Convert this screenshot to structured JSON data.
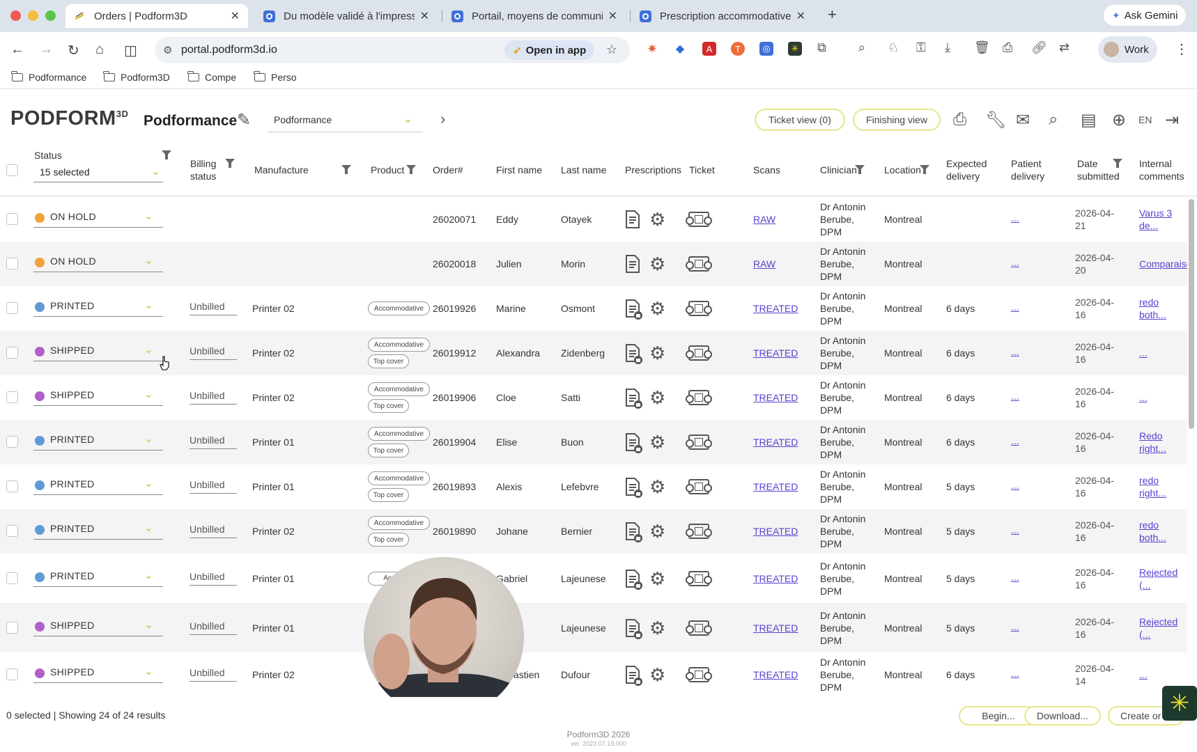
{
  "browser": {
    "tabs": [
      {
        "title": "Orders | Podform3D",
        "active": true
      },
      {
        "title": "Du modèle validé à l'impressi"
      },
      {
        "title": "Portail, moyens de communic"
      },
      {
        "title": "Prescription accommodative,"
      }
    ],
    "gemini_label": "Ask Gemini",
    "url": "portal.podform3d.io",
    "open_in_app": "Open in app",
    "profile_label": "Work",
    "bookmarks": [
      "Podformance",
      "Podform3D",
      "Compe",
      "Perso"
    ]
  },
  "app": {
    "logo": "PODFORM",
    "logo_sup": "3D",
    "org_name": "Podformance",
    "org_select": "Podformance",
    "ticket_view": "Ticket view (0)",
    "finishing_view": "Finishing view",
    "language": "EN"
  },
  "columns": {
    "status": "Status",
    "status_filter_value": "15 selected",
    "billing_1": "Billing",
    "billing_2": "status",
    "manufacture": "Manufacture",
    "product": "Product",
    "order": "Order#",
    "first_name": "First name",
    "last_name": "Last name",
    "prescriptions": "Prescriptions",
    "ticket": "Ticket",
    "scans": "Scans",
    "clinician": "Clinician",
    "location": "Location",
    "expected_1": "Expected",
    "expected_2": "delivery",
    "patient_1": "Patient",
    "patient_2": "delivery",
    "date_1": "Date",
    "date_2": "submitted",
    "comments_1": "Internal",
    "comments_2": "comments"
  },
  "colors": {
    "on_hold": "#f0a23c",
    "printed": "#5d9ad6",
    "shipped": "#b15fc9",
    "accent": "#e8e58a",
    "link": "#5b3fd0"
  },
  "rows": [
    {
      "status": "ON HOLD",
      "status_color": "#f0a23c",
      "billing": "",
      "manufacture": "",
      "tags": [],
      "order": "26020071",
      "first": "Eddy",
      "last": "Otayek",
      "scan": "RAW",
      "clin1": "Dr Antonin",
      "clin2": "Berube,",
      "clin3": "DPM",
      "location": "Montreal",
      "expected": "",
      "patient": "...",
      "date1": "2026-04-",
      "date2": "21",
      "comment1": "Varus 3",
      "comment2": "de..."
    },
    {
      "status": "ON HOLD",
      "status_color": "#f0a23c",
      "billing": "",
      "manufacture": "",
      "tags": [],
      "order": "26020018",
      "first": "Julien",
      "last": "Morin",
      "scan": "RAW",
      "clin1": "Dr Antonin",
      "clin2": "Berube,",
      "clin3": "DPM",
      "location": "Montreal",
      "expected": "",
      "patient": "...",
      "date1": "2026-04-",
      "date2": "20",
      "comment1": "Comparaiso...",
      "comment2": ""
    },
    {
      "status": "PRINTED",
      "status_color": "#5d9ad6",
      "billing": "Unbilled",
      "manufacture": "Printer 02",
      "tags": [
        "Accommodative"
      ],
      "order": "26019926",
      "first": "Marine",
      "last": "Osmont",
      "scan": "TREATED",
      "clin1": "Dr Antonin",
      "clin2": "Berube,",
      "clin3": "DPM",
      "location": "Montreal",
      "expected": "6 days",
      "patient": "...",
      "date1": "2026-04-",
      "date2": "16",
      "comment1": "redo",
      "comment2": "both..."
    },
    {
      "status": "SHIPPED",
      "status_color": "#b15fc9",
      "billing": "Unbilled",
      "manufacture": "Printer 02",
      "tags": [
        "Accommodative",
        "Top cover"
      ],
      "order": "26019912",
      "first": "Alexandra",
      "last": "Zidenberg",
      "scan": "TREATED",
      "clin1": "Dr Antonin",
      "clin2": "Berube,",
      "clin3": "DPM",
      "location": "Montreal",
      "expected": "6 days",
      "patient": "...",
      "date1": "2026-04-",
      "date2": "16",
      "comment1": "...",
      "comment2": ""
    },
    {
      "status": "SHIPPED",
      "status_color": "#b15fc9",
      "billing": "Unbilled",
      "manufacture": "Printer 02",
      "tags": [
        "Accommodative",
        "Top cover"
      ],
      "order": "26019906",
      "first": "Cloe",
      "last": "Satti",
      "scan": "TREATED",
      "clin1": "Dr Antonin",
      "clin2": "Berube,",
      "clin3": "DPM",
      "location": "Montreal",
      "expected": "6 days",
      "patient": "...",
      "date1": "2026-04-",
      "date2": "16",
      "comment1": "...",
      "comment2": ""
    },
    {
      "status": "PRINTED",
      "status_color": "#5d9ad6",
      "billing": "Unbilled",
      "manufacture": "Printer 01",
      "tags": [
        "Accommodative",
        "Top cover"
      ],
      "order": "26019904",
      "first": "Elise",
      "last": "Buon",
      "scan": "TREATED",
      "clin1": "Dr Antonin",
      "clin2": "Berube,",
      "clin3": "DPM",
      "location": "Montreal",
      "expected": "6 days",
      "patient": "...",
      "date1": "2026-04-",
      "date2": "16",
      "comment1": "Redo",
      "comment2": "right..."
    },
    {
      "status": "PRINTED",
      "status_color": "#5d9ad6",
      "billing": "Unbilled",
      "manufacture": "Printer 01",
      "tags": [
        "Accommodative",
        "Top cover"
      ],
      "order": "26019893",
      "first": "Alexis",
      "last": "Lefebvre",
      "scan": "TREATED",
      "clin1": "Dr Antonin",
      "clin2": "Berube,",
      "clin3": "DPM",
      "location": "Montreal",
      "expected": "5 days",
      "patient": "...",
      "date1": "2026-04-",
      "date2": "16",
      "comment1": "redo",
      "comment2": "right..."
    },
    {
      "status": "PRINTED",
      "status_color": "#5d9ad6",
      "billing": "Unbilled",
      "manufacture": "Printer 02",
      "tags": [
        "Accommodative",
        "Top cover"
      ],
      "order": "26019890",
      "first": "Johane",
      "last": "Bernier",
      "scan": "TREATED",
      "clin1": "Dr Antonin",
      "clin2": "Berube,",
      "clin3": "DPM",
      "location": "Montreal",
      "expected": "5 days",
      "patient": "...",
      "date1": "2026-04-",
      "date2": "16",
      "comment1": "redo",
      "comment2": "both..."
    },
    {
      "status": "PRINTED",
      "status_color": "#5d9ad6",
      "billing": "Unbilled",
      "manufacture": "Printer 01",
      "tags": [
        "Accommo"
      ],
      "order": "",
      "first": "Gabriel",
      "last": "Lajeunese",
      "scan": "TREATED",
      "clin1": "Dr Antonin",
      "clin2": "Berube,",
      "clin3": "DPM",
      "location": "Montreal",
      "expected": "5 days",
      "patient": "...",
      "date1": "2026-04-",
      "date2": "16",
      "comment1": "Rejected",
      "comment2": "(..."
    },
    {
      "status": "SHIPPED",
      "status_color": "#b15fc9",
      "billing": "Unbilled",
      "manufacture": "Printer 01",
      "tags": [],
      "order": "",
      "first": "",
      "last": "Lajeunese",
      "scan": "TREATED",
      "clin1": "Dr Antonin",
      "clin2": "Berube,",
      "clin3": "DPM",
      "location": "Montreal",
      "expected": "5 days",
      "patient": "...",
      "date1": "2026-04-",
      "date2": "16",
      "comment1": "Rejected",
      "comment2": "(..."
    },
    {
      "status": "SHIPPED",
      "status_color": "#b15fc9",
      "billing": "Unbilled",
      "manufacture": "Printer 02",
      "tags": [],
      "order": "",
      "first": "Sebastien",
      "last": "Dufour",
      "scan": "TREATED",
      "clin1": "Dr Antonin",
      "clin2": "Berube,",
      "clin3": "DPM",
      "location": "Montreal",
      "expected": "6 days",
      "patient": "...",
      "date1": "2026-04-",
      "date2": "14",
      "comment1": "...",
      "comment2": ""
    }
  ],
  "footer": {
    "summary": "0 selected | Showing 24 of 24 results",
    "begin": "Begin...",
    "download": "Download...",
    "create": "Create or",
    "copyright": "Podform3D 2026",
    "version": "ver. 2023.07.19.000"
  }
}
